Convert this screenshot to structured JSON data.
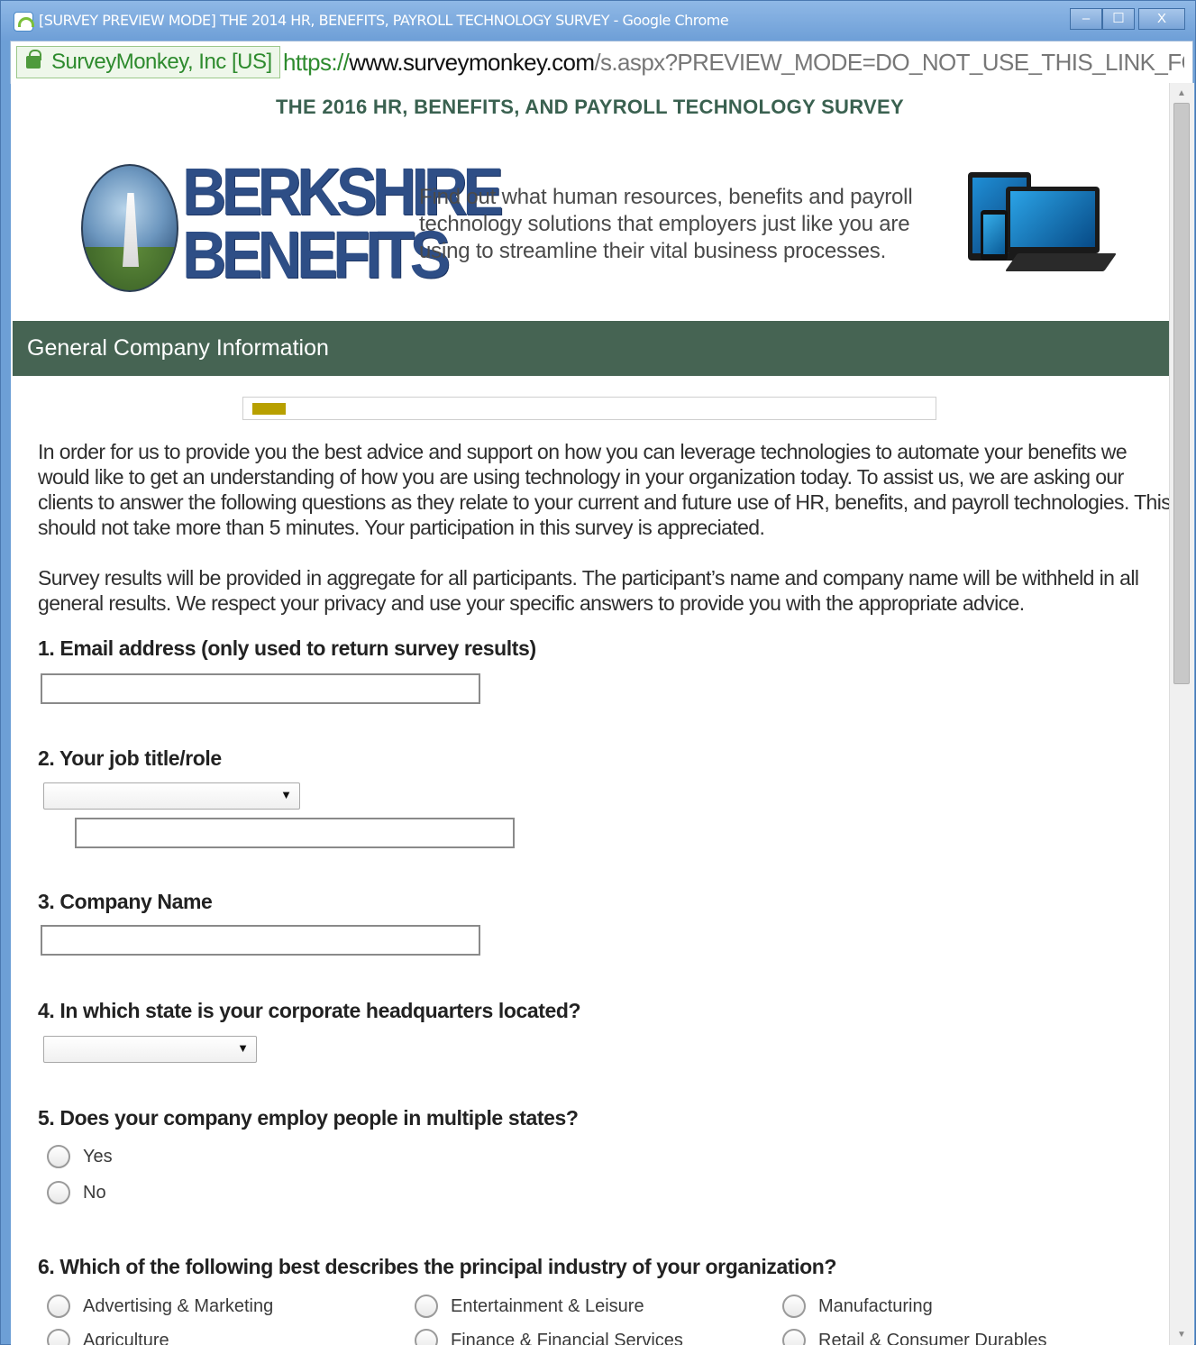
{
  "window": {
    "title": "[SURVEY PREVIEW MODE] THE 2014 HR, BENEFITS, PAYROLL TECHNOLOGY SURVEY - Google Chrome",
    "buttons": {
      "minimize": "–",
      "maximize": "☐",
      "close": "X"
    }
  },
  "addressbar": {
    "cert_label": "SurveyMonkey, Inc [US]",
    "url_scheme": "https://",
    "url_host": "www.surveymonkey.com",
    "url_path": "/s.aspx?PREVIEW_MODE=DO_NOT_USE_THIS_LINK_FOR_COI"
  },
  "survey": {
    "title": "THE 2016 HR, BENEFITS, AND PAYROLL TECHNOLOGY SURVEY",
    "brand_line1": "BERKSHIRE",
    "brand_line2": "BENEFITS",
    "tagline": "Find out what human resources, benefits and payroll technology solutions that employers just like you are using to streamline their vital business processes.",
    "section": "General Company Information",
    "progress": 0.05,
    "intro_p1": "In order for us to provide you the best advice and support on how you can leverage technologies to automate your benefits we would like to get an understanding of how you are using technology in your organization today. To assist us, we are asking our clients to answer the following questions as they relate to your current and future use of HR, benefits, and payroll technologies. This should not take more than 5 minutes. Your participation in this survey is appreciated.",
    "intro_p2": "Survey results will be provided in aggregate for all participants. The participant’s name and company name will be withheld in all general results. We respect your privacy and use your specific answers to provide you with the appropriate advice."
  },
  "questions": {
    "q1": {
      "label": "1. Email address (only used to return survey results)",
      "value": ""
    },
    "q2": {
      "label": "2. Your job title/role",
      "selected": "",
      "other_value": ""
    },
    "q3": {
      "label": "3. Company Name",
      "value": ""
    },
    "q4": {
      "label": "4. In which state is your corporate headquarters located?",
      "selected": ""
    },
    "q5": {
      "label": "5. Does your company employ people in multiple states?",
      "options": [
        "Yes",
        "No"
      ]
    },
    "q6": {
      "label": "6. Which of the following best describes the principal industry of your organization?",
      "options": [
        "Advertising & Marketing",
        "Entertainment & Leisure",
        "Manufacturing",
        "Agriculture",
        "Finance & Financial Services",
        "Retail & Consumer Durables"
      ]
    }
  },
  "colors": {
    "section_bar": "#466453",
    "title_text": "#3a6150",
    "progress_fill": "#b8a000",
    "brand": "#2e4e86"
  },
  "icons": {
    "app": "chrome-surveymonkey-icon",
    "lock": "lock-icon",
    "select_arrow": "▼"
  }
}
